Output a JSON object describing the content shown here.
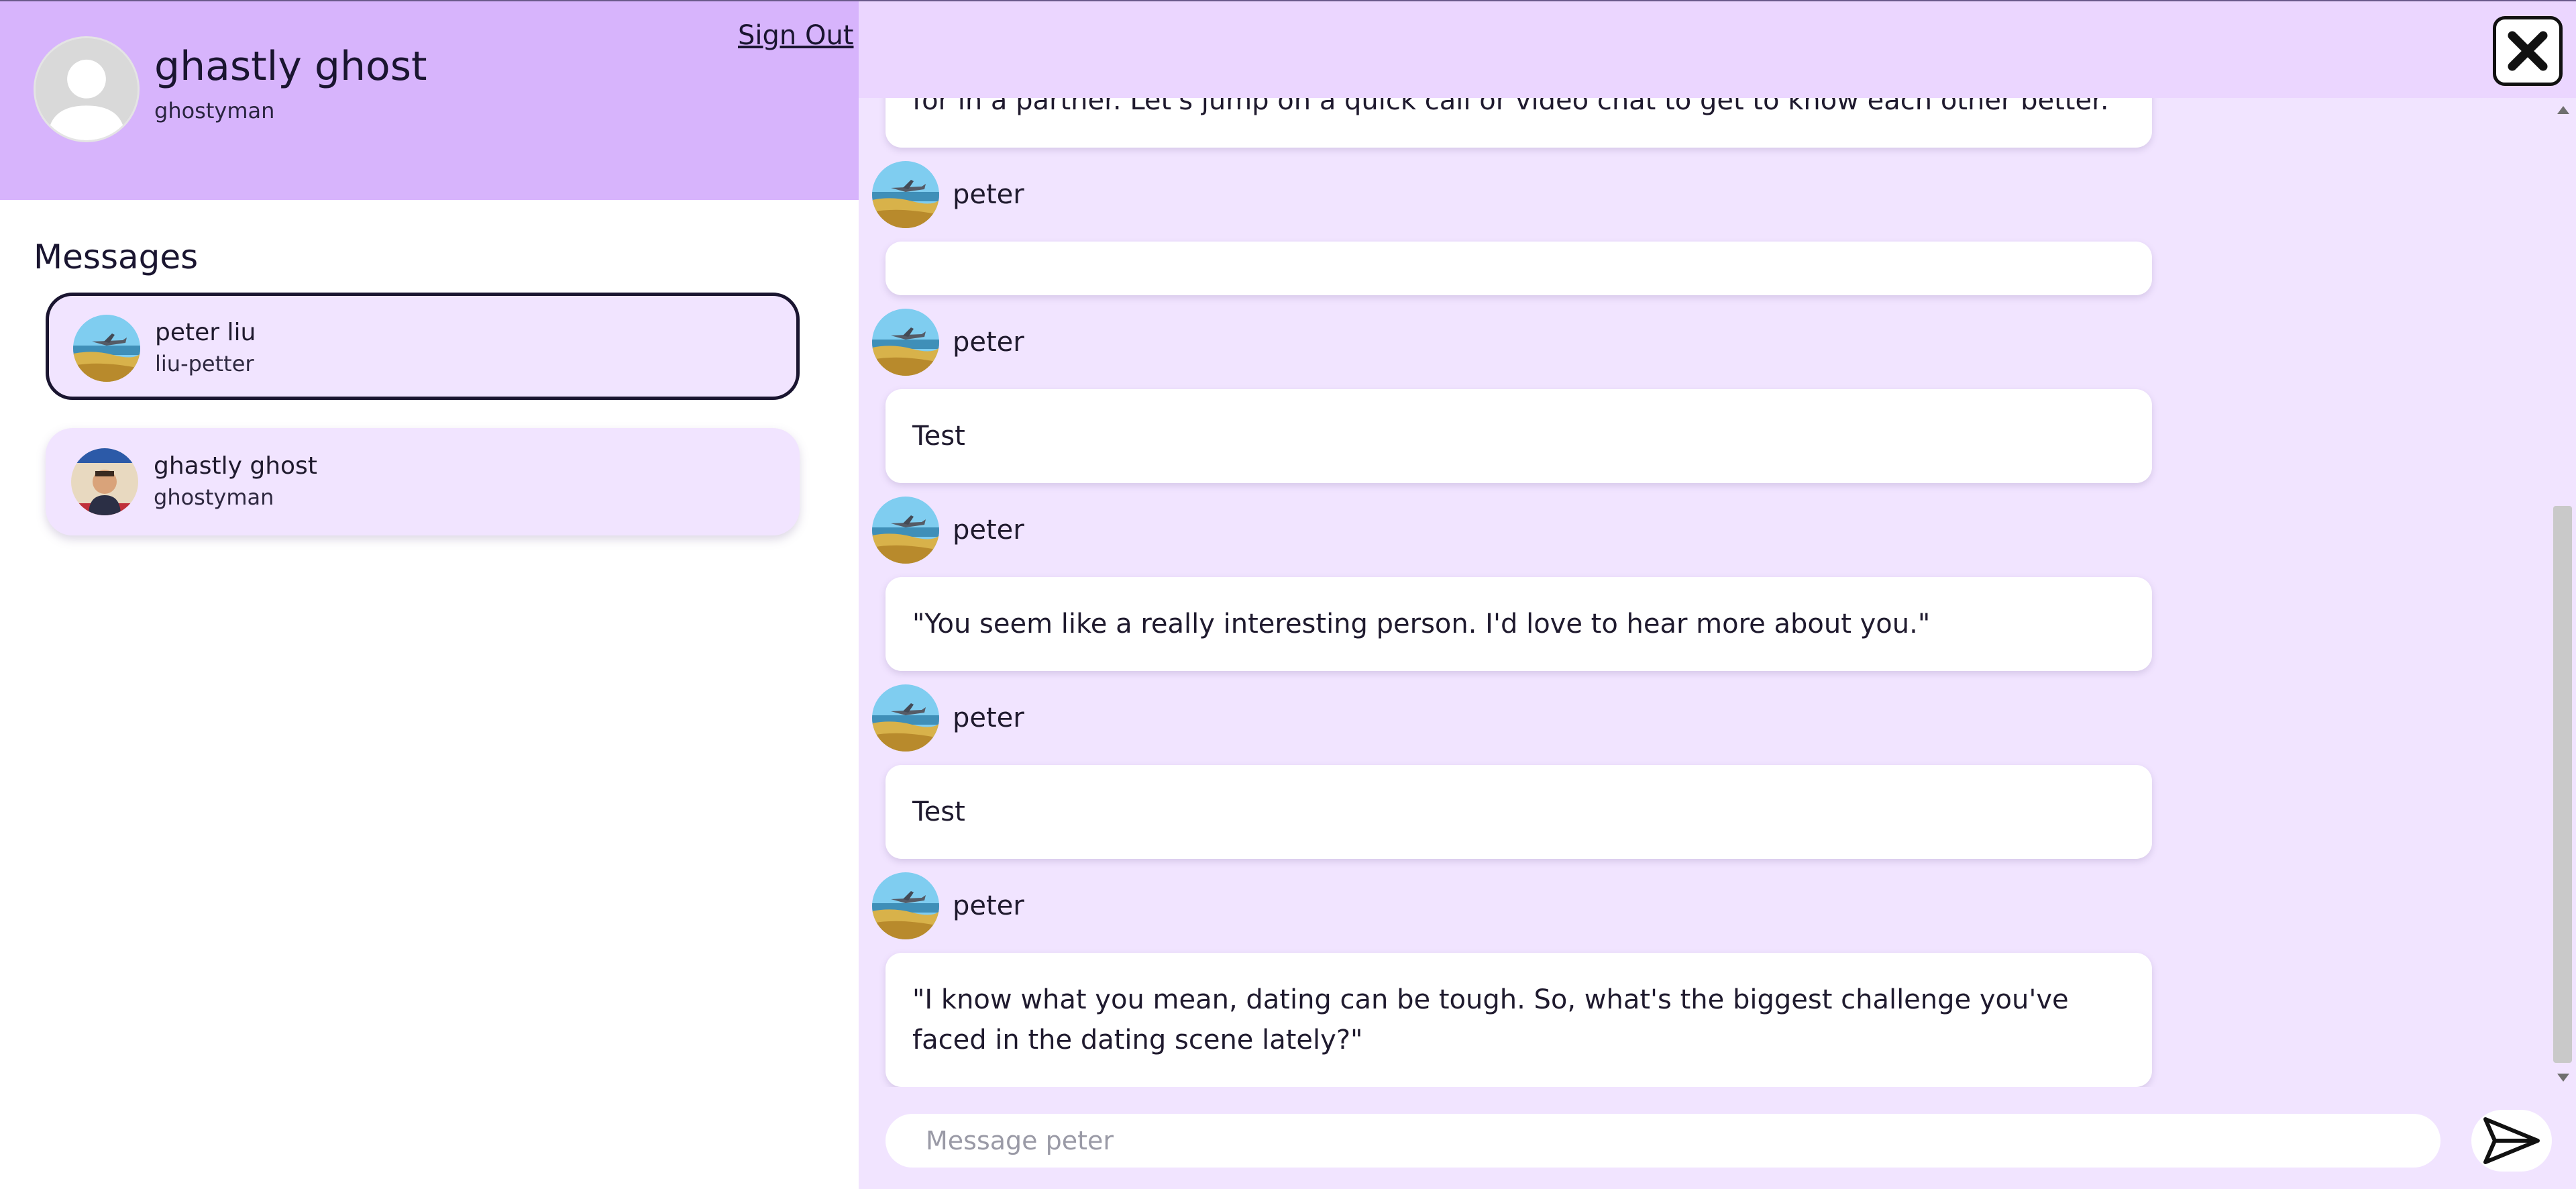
{
  "profile": {
    "name": "ghastly ghost",
    "username": "ghostyman",
    "sign_out_label": "Sign Out",
    "avatar_icon": "default-user-avatar"
  },
  "sidebar": {
    "messages_title": "Messages",
    "conversations": [
      {
        "name": "peter liu",
        "username": "liu-petter",
        "active": true,
        "avatar_icon": "airplane-beach-photo"
      },
      {
        "name": "ghastly ghost",
        "username": "ghostyman",
        "active": false,
        "avatar_icon": "vote-poster-photo"
      }
    ]
  },
  "chat": {
    "close_icon": "close-icon",
    "partial_message": "for in a partner. Let's jump on a quick call or video chat to get to know each other better.\"",
    "messages": [
      {
        "sender": "peter",
        "text": ""
      },
      {
        "sender": "peter",
        "text": "Test"
      },
      {
        "sender": "peter",
        "text": "\"You seem like a really interesting person. I'd love to hear more about you.\""
      },
      {
        "sender": "peter",
        "text": "Test"
      },
      {
        "sender": "peter",
        "text": "\"I know what you mean, dating can be tough. So, what's the biggest challenge you've faced in the dating scene lately?\""
      }
    ],
    "composer_placeholder": "Message peter",
    "send_icon": "send-icon"
  },
  "colors": {
    "profile_header": "#d7b4fc",
    "chat_background": "#f1e4ff",
    "chat_topbar": "#ebd6ff",
    "bubble": "#ffffff"
  }
}
